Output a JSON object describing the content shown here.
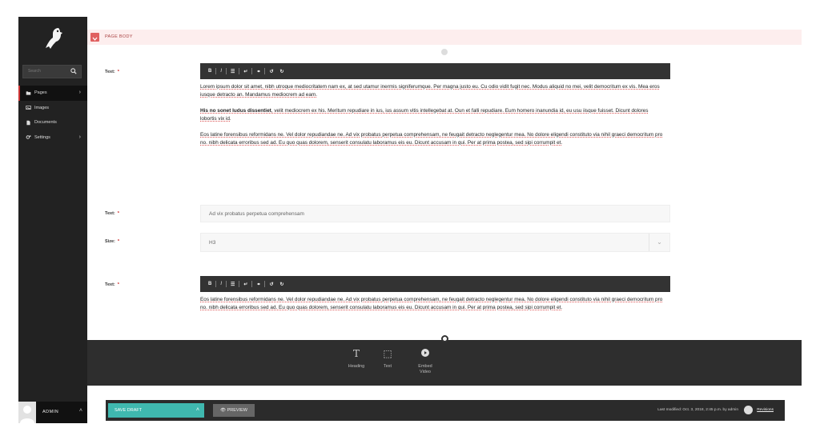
{
  "sidebar": {
    "search_placeholder": "Search",
    "items": [
      {
        "label": "Pages",
        "icon": "folder-icon",
        "active": true,
        "has_children": true
      },
      {
        "label": "Images",
        "icon": "image-icon",
        "active": false,
        "has_children": false
      },
      {
        "label": "Documents",
        "icon": "document-icon",
        "active": false,
        "has_children": false
      },
      {
        "label": "Settings",
        "icon": "cogs-icon",
        "active": false,
        "has_children": true
      }
    ],
    "user": {
      "name": "ADMIN"
    }
  },
  "section": {
    "title": "PAGE BODY"
  },
  "blocks": {
    "text1": {
      "label": "Text:",
      "required_mark": "*",
      "toolbar": [
        "B",
        "I",
        "☰",
        "↵",
        "⚭",
        "↺",
        "↻"
      ],
      "paragraphs": [
        "Lorem ipsum dolor sit amet, nibh utroque mediocritatem nam ex, at sed utamur inermis signiferumque. Per magna justo eu. Cu odio vidit fugit nec. Modus aliquid no mei, velit democritum ex vis. Mea eros iusque detracto an. Mandamus mediocrem ad eam.",
        "His no sonet ludus dissentiet, velit mediocrem ex his. Meritum repudiare in ius, ius assum vitis intellegebat at. Oun et falli repudiare. Eum homero inanundia id, eu usu iisque fuisset. Dicunt dolores lobortis vix id.",
        "Eos latine forensibus reformidans ne. Vel dolor repudiandae ne. Ad vix probatus perpetua comprehensam, ne feugait detracto neglegentur mea. No dolore eligendi constituto via nihil graeci democritum pro no. nibh delicata erroribus sed ad. Eu quo quas dolorem, senserit consulatu laboramus eis eu. Dicunt accusam in qui. Per at prima postea, sed sipi corrumpit et."
      ],
      "bold_lead": "His no sonet ludus dissentiet"
    },
    "text2": {
      "label": "Text:",
      "required_mark": "*",
      "value": "Ad vix probatus perpetua comprehensam"
    },
    "size": {
      "label": "Size:",
      "required_mark": "*",
      "value": "H3"
    },
    "text3": {
      "label": "Text:",
      "required_mark": "*",
      "toolbar": [
        "B",
        "I",
        "☰",
        "↵",
        "⚭",
        "↺",
        "↻"
      ],
      "paragraphs": [
        "Eos latine forensibus reformidans ne. Vel dolor repudiandae ne. Ad vix probatus perpetua comprehensam, ne feugait detracto neglegentur mea. No dolore eligendi constituto via nihil graeci democritum pro no. nibh delicata erroribus sed ad. Eu quo quas dolorem, senserit consulatu laboramus eis eu. Dicunt accusam in qui. Per at prima postea, sed sipi corrumpit et."
      ]
    }
  },
  "picker": {
    "options": [
      {
        "label": "Heading",
        "icon": "heading-icon",
        "glyph": "T"
      },
      {
        "label": "Text",
        "icon": "text-block-icon",
        "glyph": "⬚"
      },
      {
        "label": "Embed Video",
        "icon": "play-icon",
        "glyph": "▶"
      }
    ]
  },
  "footer": {
    "save_label": "SAVE DRAFT",
    "preview_label": "PREVIEW",
    "last_modified": "Last modified: Oct. 3, 2018, 2:45 p.m. by admin",
    "revisions_label": "Revisions"
  },
  "colors": {
    "accent": "#3fb8af",
    "danger": "#e06060",
    "sidebar": "#222222"
  }
}
